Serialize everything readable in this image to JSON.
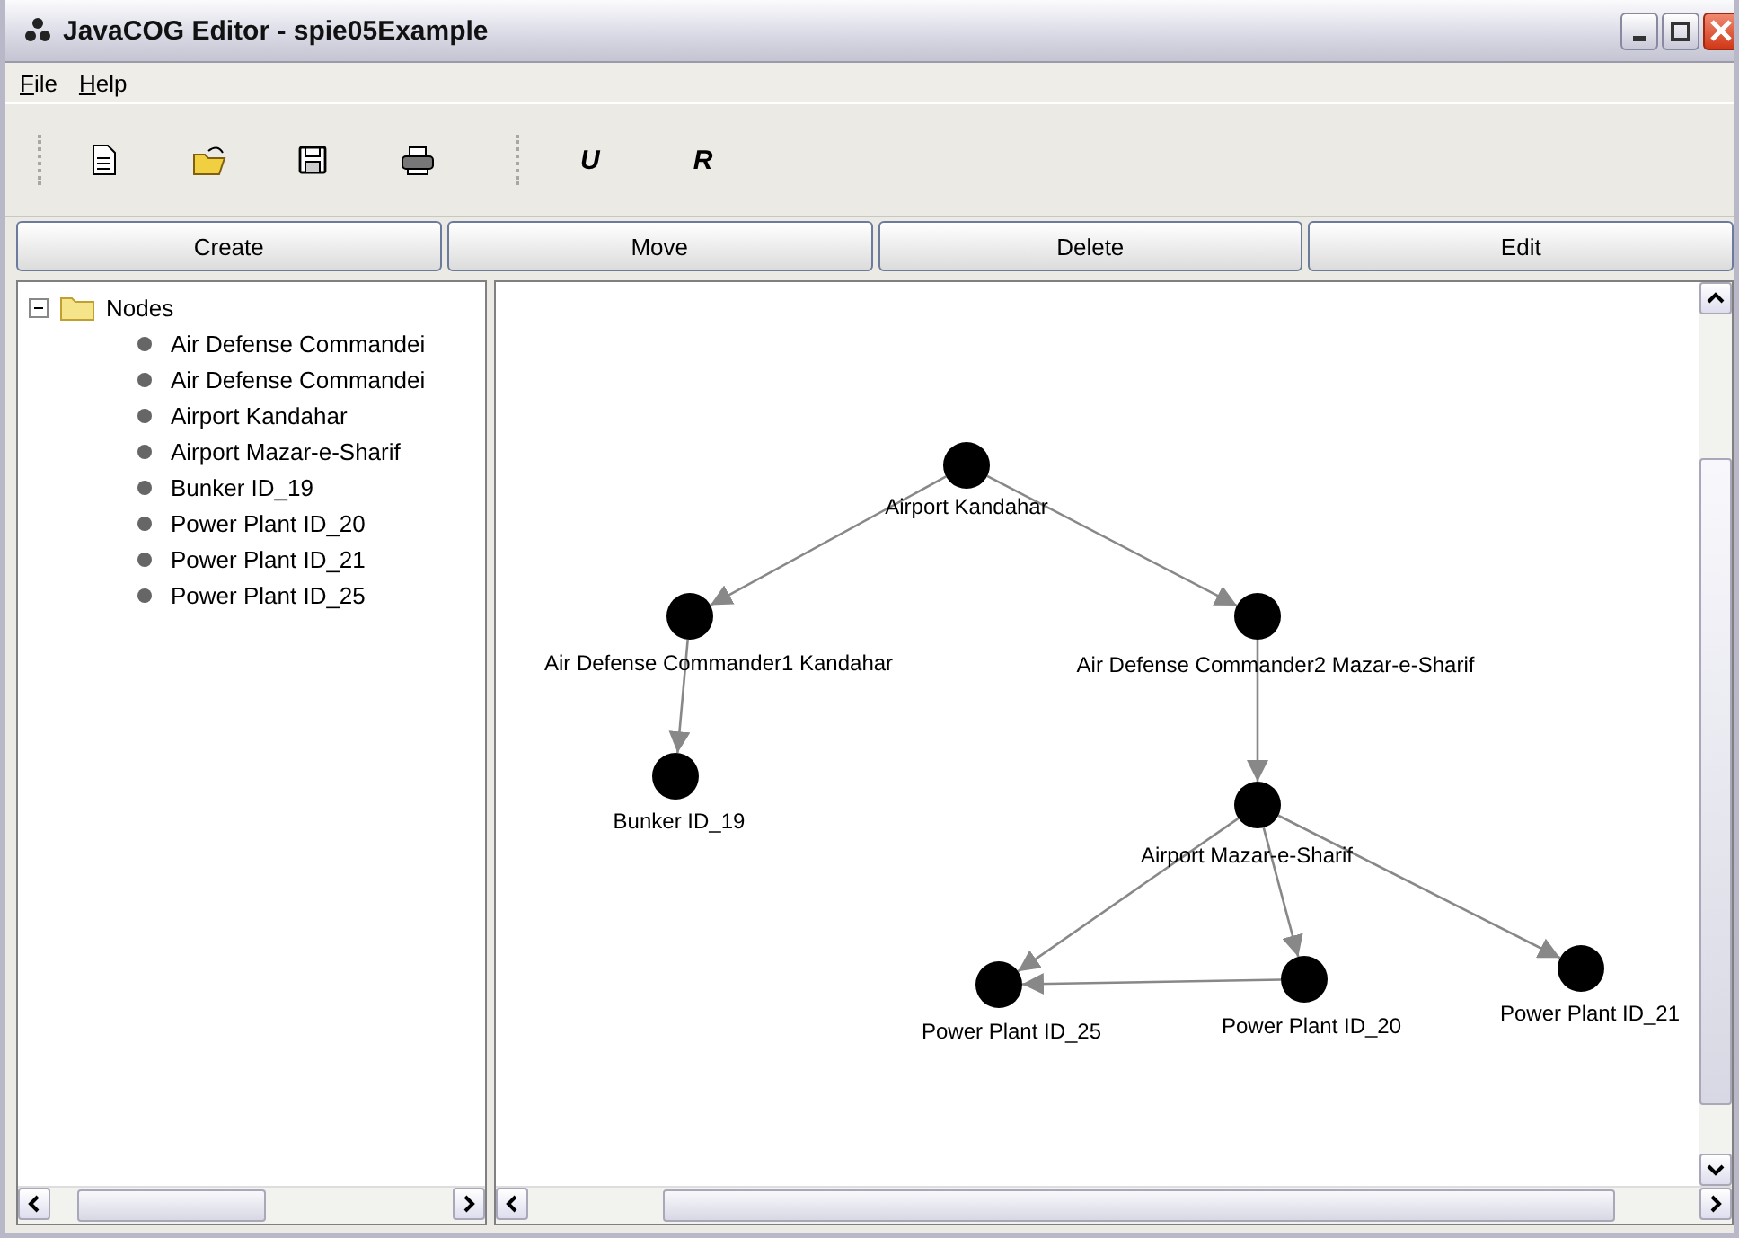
{
  "window": {
    "title": "JavaCOG Editor - spie05Example"
  },
  "menu": [
    {
      "label": "File"
    },
    {
      "label": "Help"
    }
  ],
  "toolbar": [
    {
      "kind": "new"
    },
    {
      "kind": "open"
    },
    {
      "kind": "save"
    },
    {
      "kind": "print"
    },
    {
      "kind": "separator"
    },
    {
      "kind": "text",
      "label": "U"
    },
    {
      "kind": "text",
      "label": "R"
    }
  ],
  "actions": [
    "Create",
    "Move",
    "Delete",
    "Edit"
  ],
  "tree": {
    "label": "Nodes",
    "expanded": true,
    "children": [
      {
        "label": "Air Defense Commandei"
      },
      {
        "label": "Air Defense Commandei"
      },
      {
        "label": "Airport Kandahar"
      },
      {
        "label": "Airport Mazar-e-Sharif"
      },
      {
        "label": "Bunker ID_19"
      },
      {
        "label": "Power Plant ID_20"
      },
      {
        "label": "Power Plant ID_21"
      },
      {
        "label": "Power Plant ID_25"
      }
    ]
  },
  "graph": {
    "nodes": [
      {
        "label": "Airport Kandahar"
      },
      {
        "label": "Air Defense Commander1 Kandahar"
      },
      {
        "label": "Air Defense Commander2 Mazar-e-Sharif"
      },
      {
        "label": "Bunker ID_19"
      },
      {
        "label": "Airport Mazar-e-Sharif"
      },
      {
        "label": "Power Plant ID_25"
      },
      {
        "label": "Power Plant ID_20"
      },
      {
        "label": "Power Plant ID_21"
      }
    ]
  }
}
